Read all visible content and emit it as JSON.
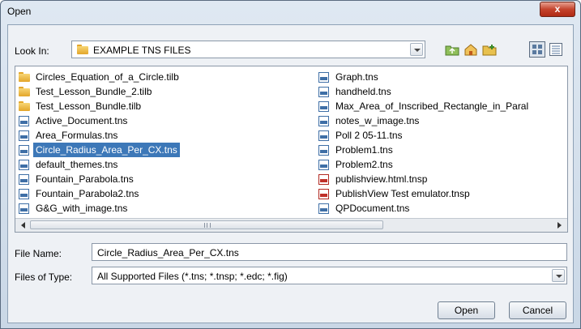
{
  "window": {
    "title": "Open",
    "close_glyph": "x"
  },
  "look_in": {
    "label": "Look In:",
    "value": "EXAMPLE TNS FILES"
  },
  "toolbar": {
    "icons": [
      "up-folder-icon",
      "home-icon",
      "new-folder-icon",
      "list-view-icon",
      "details-view-icon"
    ]
  },
  "files": {
    "col1": [
      {
        "name": "Circles_Equation_of_a_Circle.tilb",
        "type": "folder"
      },
      {
        "name": "Test_Lesson_Bundle_2.tilb",
        "type": "folder"
      },
      {
        "name": "Test_Lesson_Bundle.tilb",
        "type": "folder"
      },
      {
        "name": "Active_Document.tns",
        "type": "tns"
      },
      {
        "name": "Area_Formulas.tns",
        "type": "tns"
      },
      {
        "name": "Circle_Radius_Area_Per_CX.tns",
        "type": "tns",
        "selected": true
      },
      {
        "name": "default_themes.tns",
        "type": "tns"
      },
      {
        "name": "Fountain_Parabola.tns",
        "type": "tns"
      },
      {
        "name": "Fountain_Parabola2.tns",
        "type": "tns"
      },
      {
        "name": "G&G_with_image.tns",
        "type": "tns"
      }
    ],
    "col2": [
      {
        "name": "Graph.tns",
        "type": "tns"
      },
      {
        "name": "handheld.tns",
        "type": "tns"
      },
      {
        "name": "Max_Area_of_Inscribed_Rectangle_in_Paral",
        "type": "tns"
      },
      {
        "name": "notes_w_image.tns",
        "type": "tns"
      },
      {
        "name": "Poll 2 05-11.tns",
        "type": "tns"
      },
      {
        "name": "Problem1.tns",
        "type": "tns"
      },
      {
        "name": "Problem2.tns",
        "type": "tns"
      },
      {
        "name": "publishview.html.tnsp",
        "type": "tnsp"
      },
      {
        "name": "PublishView Test emulator.tnsp",
        "type": "tnsp"
      },
      {
        "name": "QPDocument.tns",
        "type": "tns"
      }
    ]
  },
  "file_name": {
    "label": "File Name:",
    "value": "Circle_Radius_Area_Per_CX.tns"
  },
  "file_type": {
    "label": "Files of Type:",
    "value": "All Supported Files (*.tns; *.tnsp; *.edc; *.fig)"
  },
  "buttons": {
    "open": "Open",
    "cancel": "Cancel"
  },
  "colors": {
    "selection": "#3d78b8",
    "close": "#c4432c"
  }
}
